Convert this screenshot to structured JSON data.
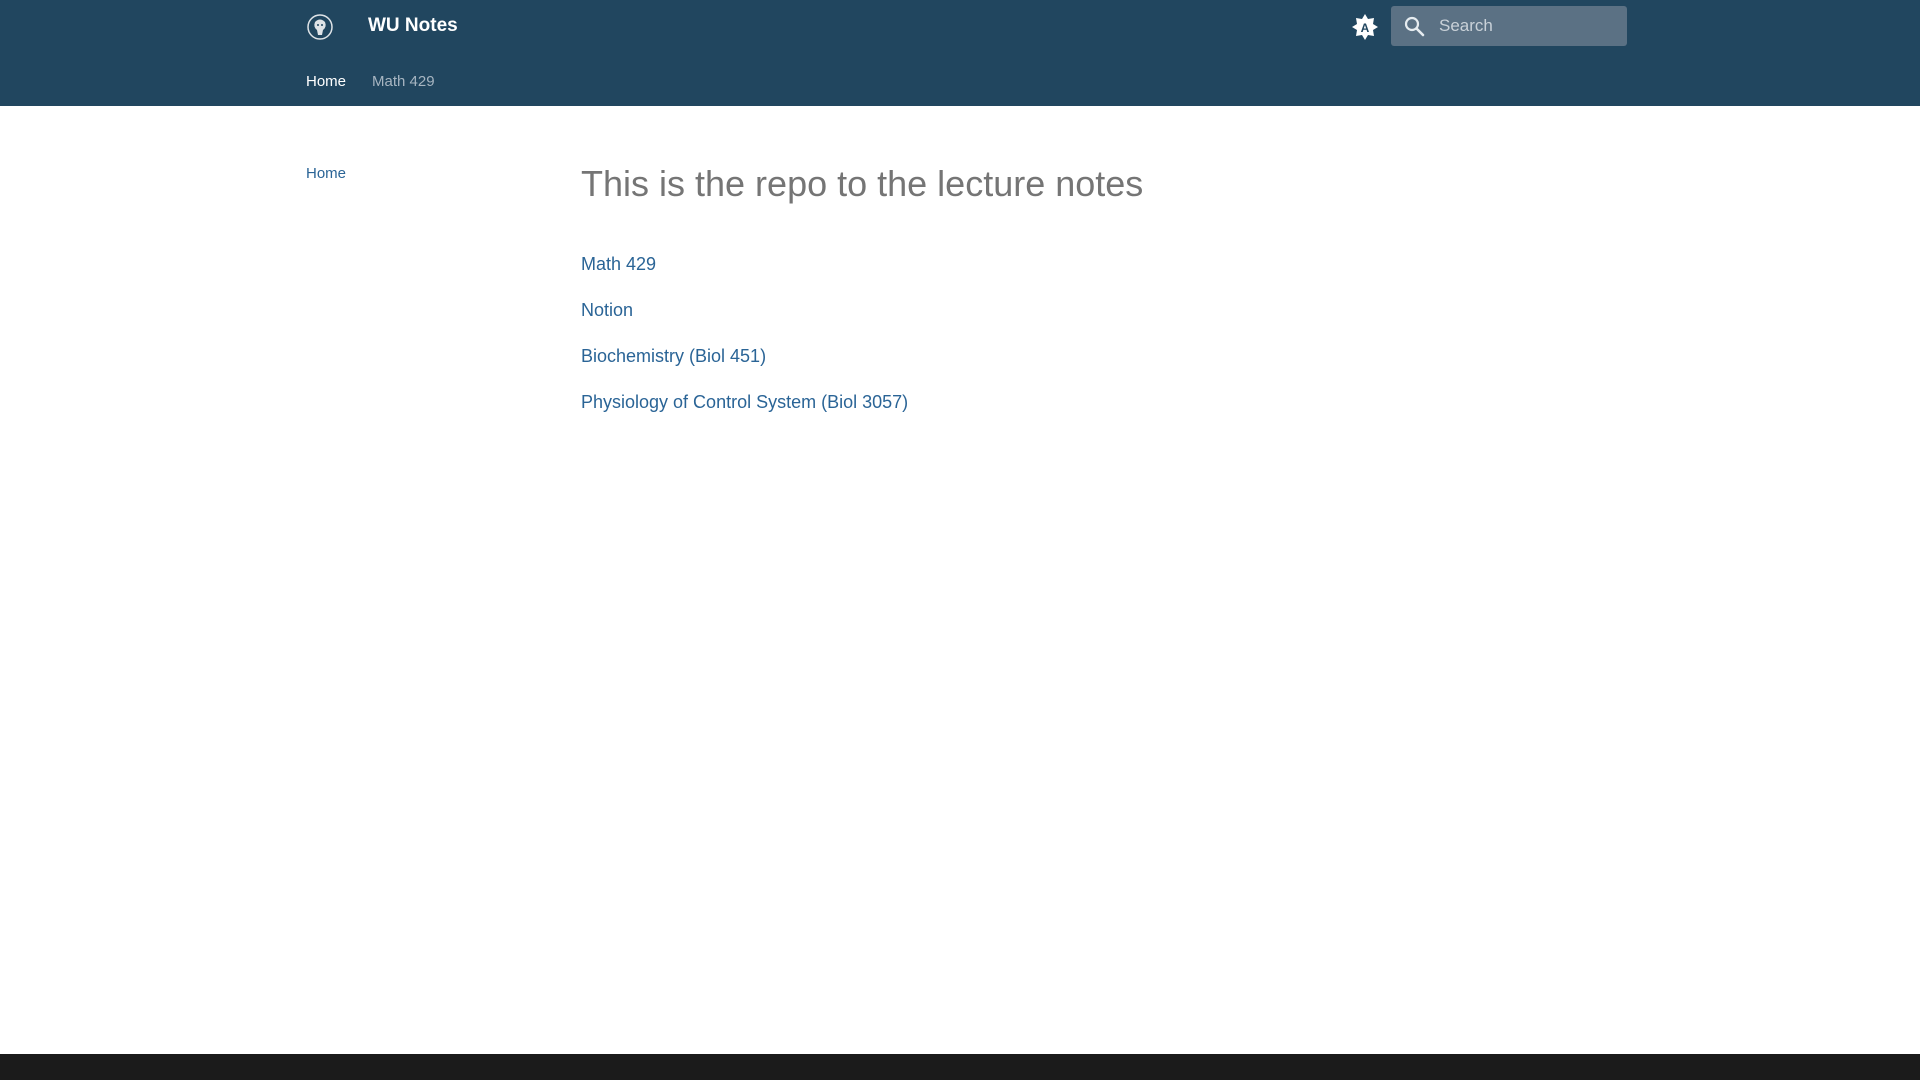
{
  "header": {
    "title": "WU Notes",
    "logo_icon": "lion-head-logo-icon",
    "theme_toggle_icon": "brightness-auto-icon",
    "search": {
      "placeholder": "Search",
      "icon": "search-icon"
    },
    "tabs": [
      {
        "label": "Home",
        "active": true
      },
      {
        "label": "Math 429",
        "active": false
      }
    ]
  },
  "sidebar": {
    "items": [
      {
        "label": "Home"
      }
    ]
  },
  "main": {
    "title": "This is the repo to the lecture notes",
    "links": [
      {
        "label": "Math 429"
      },
      {
        "label": "Notion"
      },
      {
        "label": "Biochemistry (Biol 451)"
      },
      {
        "label": "Physiology of Control System (Biol 3057)"
      }
    ]
  },
  "colors": {
    "header_bg": "#21465f",
    "link": "#2a6496",
    "title": "#757575",
    "footer_bg": "#1b1b1b"
  }
}
